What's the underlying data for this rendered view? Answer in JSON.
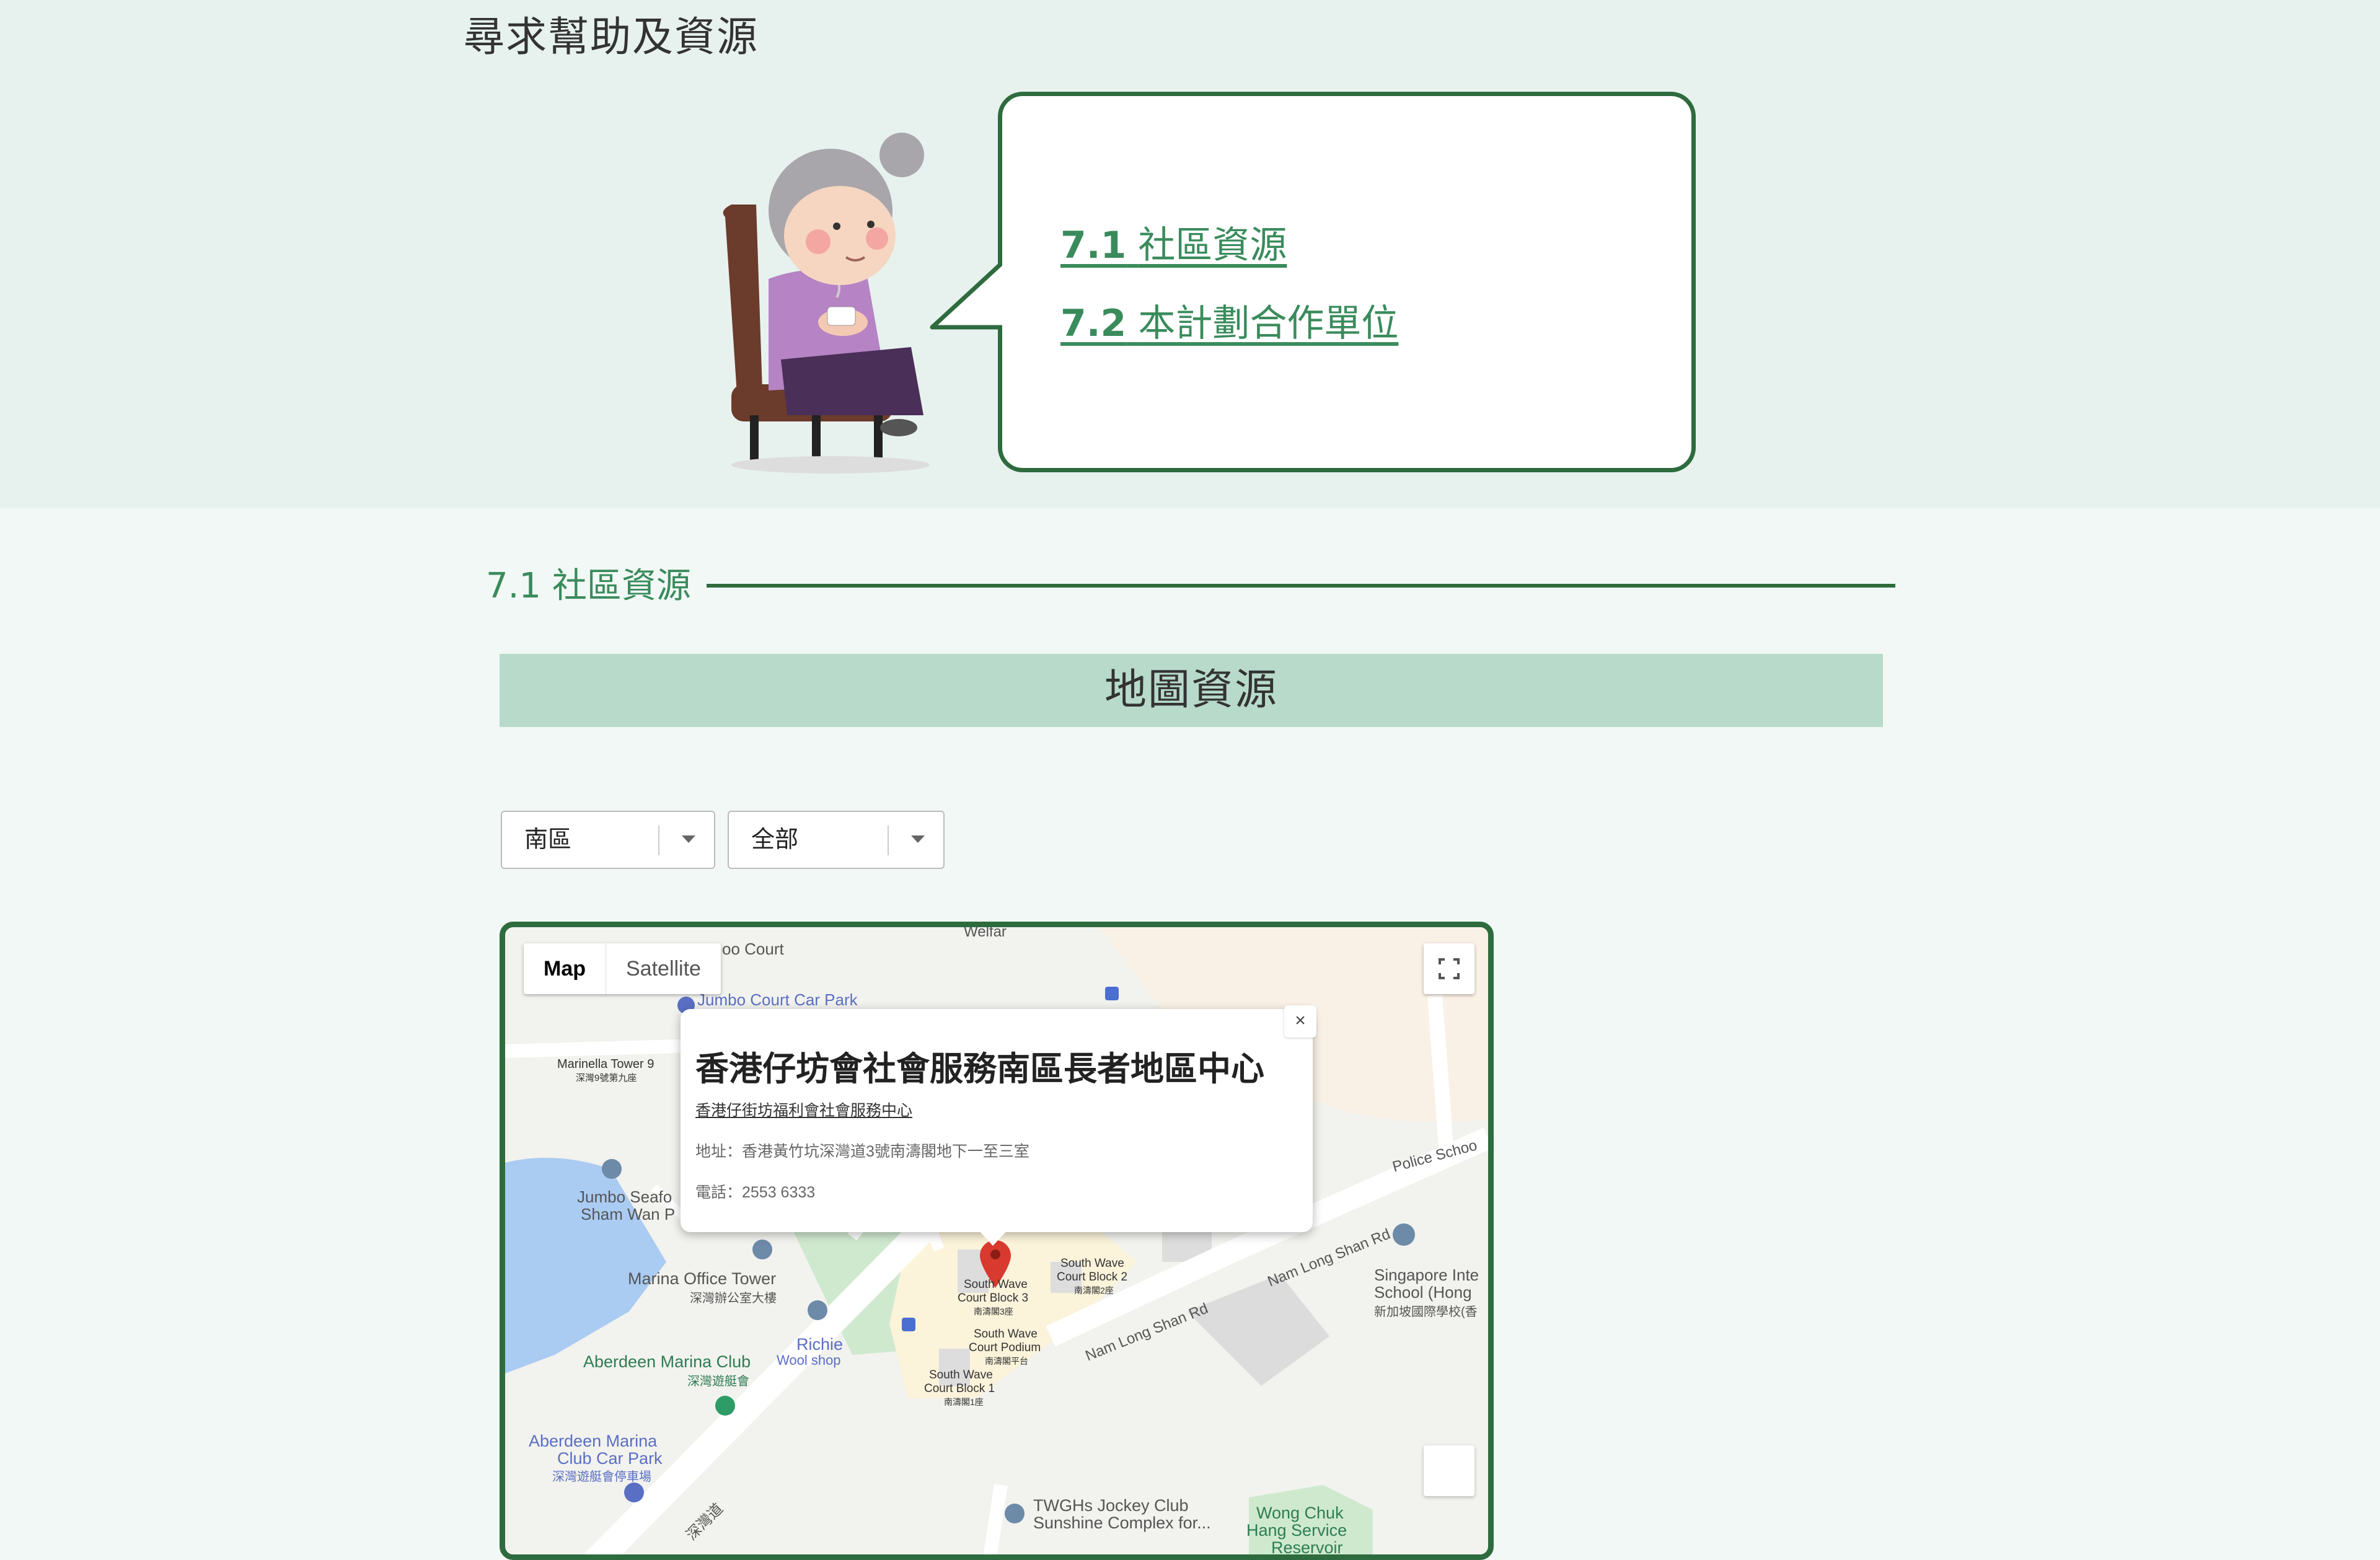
{
  "page": {
    "title": "尋求幫助及資源"
  },
  "bubble": {
    "links": [
      {
        "number": "7.1",
        "label": "社區資源"
      },
      {
        "number": "7.2",
        "label": "本計劃合作單位"
      }
    ]
  },
  "section": {
    "heading": "7.1 社區資源",
    "banner": "地圖資源"
  },
  "filters": {
    "district": "南區",
    "category": "全部"
  },
  "map": {
    "toggle": {
      "map": "Map",
      "satellite": "Satellite"
    },
    "labels": {
      "court": "oo Court",
      "car_park": "Jumbo Court Car Park",
      "marinella": "Marinella Tower 9",
      "marinella_zh": "深灣9號第九座",
      "jumbo_seafood": "Jumbo Seafo",
      "sham_wan": "Sham Wan P",
      "marina_office": "Marina Office Tower",
      "marina_office_zh": "深灣辦公室大樓",
      "richie": "Richie",
      "wool_shop": "Wool shop",
      "aberdeen_marina_club": "Aberdeen Marina Club",
      "aberdeen_marina_club_zh": "深灣遊艇會",
      "aberdeen_car_park_1": "Aberdeen Marina",
      "aberdeen_car_park_2": "Club Car Park",
      "aberdeen_car_park_zh": "深灣遊艇會停車場",
      "sham_wan_road": "深灣道",
      "south_wave_3a": "South Wave",
      "south_wave_3b": "Court Block 3",
      "south_wave_3_zh": "南濤閣3座",
      "south_wave_2a": "South Wave",
      "south_wave_2b": "Court Block 2",
      "south_wave_2_zh": "南濤閣2座",
      "podium_a": "South Wave",
      "podium_b": "Court Podium",
      "podium_zh": "南濤閣平台",
      "block1_a": "South Wave",
      "block1_b": "Court Block 1",
      "block1_zh": "南濤閣1座",
      "nam_long_shan_rd": "Nam Long Shan Rd",
      "nam_long_shan_rd2": "Nam Long Shan Rd",
      "police_school": "Police Schoo",
      "singapore_school_1": "Singapore Inte",
      "singapore_school_2": "School (Hong",
      "singapore_school_zh": "新加坡國際學校(香",
      "twghs_1": "TWGHs Jockey Club",
      "twghs_2": "Sunshine Complex for...",
      "wong_chuk_1": "Wong Chuk",
      "wong_chuk_2": "Hang Service",
      "wong_chuk_3": "Reservoir",
      "weifar": "Welfar"
    }
  },
  "infowindow": {
    "title": "香港仔坊會社會服務南區長者地區中心",
    "organization": "香港仔街坊福利會社會服務中心",
    "address": "地址：香港黃竹坑深灣道3號南濤閣地下一至三室",
    "phone": "電話：2553 6333",
    "close": "×"
  },
  "colors": {
    "accent_green": "#2e6b3e",
    "link_green": "#3a8b5c",
    "banner_bg": "#b7dacb",
    "marker_red": "#d93a2f"
  }
}
